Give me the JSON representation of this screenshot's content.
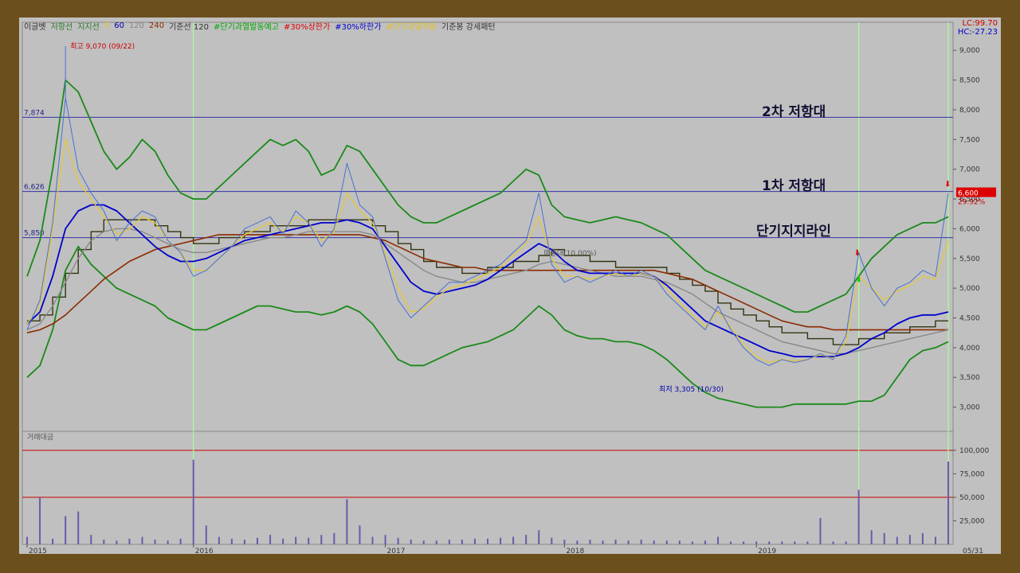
{
  "legend": {
    "items": [
      {
        "label": "이글벳",
        "color": "#333333"
      },
      {
        "label": "저항선",
        "color": "#2a7a2a"
      },
      {
        "label": "지지선",
        "color": "#2a7a2a"
      },
      {
        "label": "5",
        "color": "#e0c020"
      },
      {
        "label": "60",
        "color": "#0000aa"
      },
      {
        "label": "120",
        "color": "#888888"
      },
      {
        "label": "240",
        "color": "#8b2a00"
      },
      {
        "label": "기준선 120",
        "color": "#333333"
      },
      {
        "label": "#단기과열발동예고",
        "color": "#00aa00"
      },
      {
        "label": "#30%상한가",
        "color": "#dd0000"
      },
      {
        "label": "#30%하한가",
        "color": "#0000cc"
      },
      {
        "label": "#단기과열적용",
        "color": "#e0c020"
      },
      {
        "label": "기준봉 강세패턴",
        "color": "#333333"
      }
    ],
    "lc": "LC:99.70",
    "hc": "HC:-27.23"
  },
  "annotations": {
    "resistance2": "2차 저항대",
    "resistance1": "1차 저항대",
    "support": "단기지지라인",
    "high_label": "최고 9,070 (09/22)",
    "low_label": "최저 3,305 (10/30)",
    "price_tag": "6,600",
    "pct_tag": "29.92%",
    "mid_label": "매물대(10.00%)",
    "level_7874": "7,874",
    "level_6626": "6,626",
    "level_5850": "5,850",
    "volume_panel_title": "거래대금",
    "date_end": "05/31"
  },
  "colors": {
    "panel_bg": "#c0c0c0",
    "frame": "#6b4f1d",
    "price_line": "#4a6fd0",
    "ma5": "#e8c830",
    "ma60": "#0000cc",
    "ma120": "#888888",
    "ma240": "#8b2a00",
    "bollinger": "#1a8a1a",
    "base_line": "#333311",
    "hline": "#3333aa",
    "volume": "#6a5aaa"
  },
  "chart_data": {
    "type": "line",
    "title": "",
    "x_ticks": [
      "2015",
      "2016",
      "2017",
      "2018",
      "2019"
    ],
    "y_ticks": [
      3000,
      3500,
      4000,
      4500,
      5000,
      5500,
      6000,
      6500,
      7000,
      7500,
      8000,
      8500,
      9000
    ],
    "y_tick_labels": [
      "3,000",
      "3,500",
      "4,000",
      "4,500",
      "5,000",
      "5,500",
      "6,000",
      "6,500",
      "7,000",
      "7,500",
      "8,000",
      "8,500",
      "9,000"
    ],
    "ylim": [
      2700,
      9150
    ],
    "horizontal_levels": [
      7874,
      6626,
      5850
    ],
    "x_index": [
      0,
      1,
      2,
      3,
      4,
      5,
      6,
      7,
      8,
      9,
      10,
      11,
      12,
      13,
      14,
      15,
      16,
      17,
      18,
      19,
      20,
      21,
      22,
      23,
      24,
      25,
      26,
      27,
      28,
      29,
      30,
      31,
      32,
      33,
      34,
      35,
      36,
      37,
      38,
      39,
      40,
      41,
      42,
      43,
      44,
      45,
      46,
      47,
      48,
      49,
      50,
      51,
      52,
      53,
      54,
      55,
      56,
      57,
      58,
      59,
      60,
      61,
      62,
      63,
      64,
      65,
      66,
      67,
      68,
      69,
      70,
      71,
      72
    ],
    "series": [
      {
        "name": "이글벳",
        "values": [
          4300,
          4800,
          6100,
          8200,
          7000,
          6600,
          6300,
          5800,
          6100,
          6300,
          6200,
          5800,
          5600,
          5200,
          5300,
          5500,
          5700,
          6000,
          6100,
          6200,
          5900,
          6300,
          6100,
          5700,
          6000,
          7100,
          6400,
          6200,
          5500,
          4800,
          4500,
          4700,
          4900,
          5100,
          5100,
          5200,
          5300,
          5400,
          5600,
          5800,
          6600,
          5400,
          5100,
          5200,
          5100,
          5200,
          5300,
          5200,
          5300,
          5200,
          4900,
          4700,
          4500,
          4300,
          4700,
          4300,
          4000,
          3800,
          3700,
          3800,
          3750,
          3800,
          3900,
          3800,
          4200,
          5600,
          5000,
          4700,
          5000,
          5100,
          5300,
          5200,
          6600
        ]
      },
      {
        "name": "5",
        "values": [
          4400,
          4700,
          6000,
          7500,
          6800,
          6500,
          6200,
          5900,
          6000,
          6200,
          6100,
          5800,
          5600,
          5300,
          5300,
          5500,
          5700,
          5900,
          6000,
          6100,
          5950,
          6200,
          6100,
          5800,
          5950,
          6600,
          6300,
          6100,
          5600,
          5000,
          4600,
          4650,
          4850,
          5000,
          5050,
          5150,
          5250,
          5350,
          5550,
          5750,
          6200,
          5500,
          5200,
          5200,
          5150,
          5200,
          5250,
          5200,
          5250,
          5200,
          5000,
          4750,
          4550,
          4350,
          4600,
          4350,
          4050,
          3850,
          3750,
          3800,
          3780,
          3800,
          3880,
          3820,
          4100,
          5200,
          5000,
          4800,
          4950,
          5050,
          5200,
          5150,
          5800
        ]
      },
      {
        "name": "60",
        "values": [
          4400,
          4600,
          5200,
          6000,
          6300,
          6400,
          6400,
          6300,
          6100,
          5900,
          5700,
          5550,
          5450,
          5450,
          5500,
          5600,
          5700,
          5800,
          5850,
          5900,
          5950,
          6000,
          6050,
          6100,
          6100,
          6150,
          6100,
          6000,
          5700,
          5400,
          5100,
          4950,
          4900,
          4950,
          5000,
          5050,
          5150,
          5300,
          5450,
          5600,
          5750,
          5650,
          5450,
          5300,
          5250,
          5250,
          5250,
          5250,
          5250,
          5200,
          5050,
          4850,
          4650,
          4450,
          4350,
          4250,
          4150,
          4050,
          3950,
          3900,
          3850,
          3850,
          3850,
          3850,
          3900,
          4000,
          4150,
          4250,
          4400,
          4500,
          4550,
          4550,
          4600
        ]
      },
      {
        "name": "120",
        "values": [
          4300,
          4400,
          4700,
          5100,
          5500,
          5800,
          5950,
          6000,
          6000,
          5950,
          5850,
          5750,
          5650,
          5600,
          5600,
          5650,
          5700,
          5750,
          5800,
          5850,
          5850,
          5900,
          5950,
          5950,
          5950,
          5950,
          5950,
          5900,
          5750,
          5600,
          5450,
          5300,
          5200,
          5150,
          5100,
          5100,
          5150,
          5200,
          5250,
          5300,
          5400,
          5450,
          5400,
          5350,
          5300,
          5250,
          5200,
          5200,
          5200,
          5150,
          5100,
          5000,
          4900,
          4750,
          4600,
          4500,
          4400,
          4300,
          4200,
          4100,
          4050,
          4000,
          3950,
          3900,
          3900,
          3950,
          4000,
          4050,
          4100,
          4150,
          4200,
          4250,
          4300
        ]
      },
      {
        "name": "240",
        "values": [
          4250,
          4300,
          4400,
          4550,
          4750,
          4950,
          5150,
          5300,
          5450,
          5550,
          5650,
          5700,
          5750,
          5800,
          5850,
          5900,
          5900,
          5900,
          5900,
          5900,
          5900,
          5900,
          5900,
          5900,
          5900,
          5900,
          5900,
          5850,
          5800,
          5700,
          5600,
          5500,
          5450,
          5400,
          5350,
          5350,
          5300,
          5300,
          5300,
          5300,
          5300,
          5300,
          5300,
          5300,
          5300,
          5300,
          5300,
          5300,
          5300,
          5300,
          5250,
          5200,
          5150,
          5050,
          4950,
          4850,
          4750,
          4650,
          4550,
          4450,
          4400,
          4350,
          4350,
          4300,
          4300,
          4300,
          4300,
          4300,
          4300,
          4300,
          4300,
          4300,
          4300
        ]
      },
      {
        "name": "저항선",
        "values": [
          5200,
          5800,
          7000,
          8500,
          8300,
          7800,
          7300,
          7000,
          7200,
          7500,
          7300,
          6900,
          6600,
          6500,
          6500,
          6700,
          6900,
          7100,
          7300,
          7500,
          7400,
          7500,
          7300,
          6900,
          7000,
          7400,
          7300,
          7000,
          6700,
          6400,
          6200,
          6100,
          6100,
          6200,
          6300,
          6400,
          6500,
          6600,
          6800,
          7000,
          6900,
          6400,
          6200,
          6150,
          6100,
          6150,
          6200,
          6150,
          6100,
          6000,
          5900,
          5700,
          5500,
          5300,
          5200,
          5100,
          5000,
          4900,
          4800,
          4700,
          4600,
          4600,
          4700,
          4800,
          4900,
          5200,
          5500,
          5700,
          5900,
          6000,
          6100,
          6100,
          6200
        ]
      },
      {
        "name": "지지선",
        "values": [
          3500,
          3700,
          4300,
          5300,
          5700,
          5400,
          5200,
          5000,
          4900,
          4800,
          4700,
          4500,
          4400,
          4300,
          4300,
          4400,
          4500,
          4600,
          4700,
          4700,
          4650,
          4600,
          4600,
          4550,
          4600,
          4700,
          4600,
          4400,
          4100,
          3800,
          3700,
          3700,
          3800,
          3900,
          4000,
          4050,
          4100,
          4200,
          4300,
          4500,
          4700,
          4550,
          4300,
          4200,
          4150,
          4150,
          4100,
          4100,
          4050,
          3950,
          3800,
          3600,
          3400,
          3250,
          3150,
          3100,
          3050,
          3000,
          3000,
          3000,
          3050,
          3050,
          3050,
          3050,
          3050,
          3100,
          3100,
          3200,
          3500,
          3800,
          3950,
          4000,
          4100
        ]
      }
    ],
    "volume": {
      "name": "거래대금",
      "y_ticks": [
        25000,
        50000,
        75000,
        100000
      ],
      "y_tick_labels": [
        "25,000",
        "50,000",
        "75,000",
        "100,000"
      ],
      "ylim": [
        0,
        110000
      ],
      "values": [
        8000,
        50000,
        6000,
        30000,
        35000,
        10000,
        5000,
        4000,
        6000,
        8000,
        5000,
        4000,
        6000,
        90000,
        20000,
        8000,
        6000,
        5000,
        7000,
        10000,
        6000,
        8000,
        7000,
        10000,
        12000,
        48000,
        20000,
        8000,
        10000,
        7000,
        5000,
        4000,
        4000,
        5000,
        5000,
        6000,
        6000,
        7000,
        8000,
        10000,
        15000,
        7000,
        5000,
        4000,
        5000,
        4000,
        5000,
        4000,
        5000,
        4000,
        4000,
        4000,
        3000,
        4000,
        8000,
        3000,
        3000,
        3000,
        3000,
        3000,
        3000,
        3000,
        28000,
        3000,
        3000,
        58000,
        15000,
        12000,
        8000,
        10000,
        12000,
        8000,
        88000
      ]
    }
  }
}
